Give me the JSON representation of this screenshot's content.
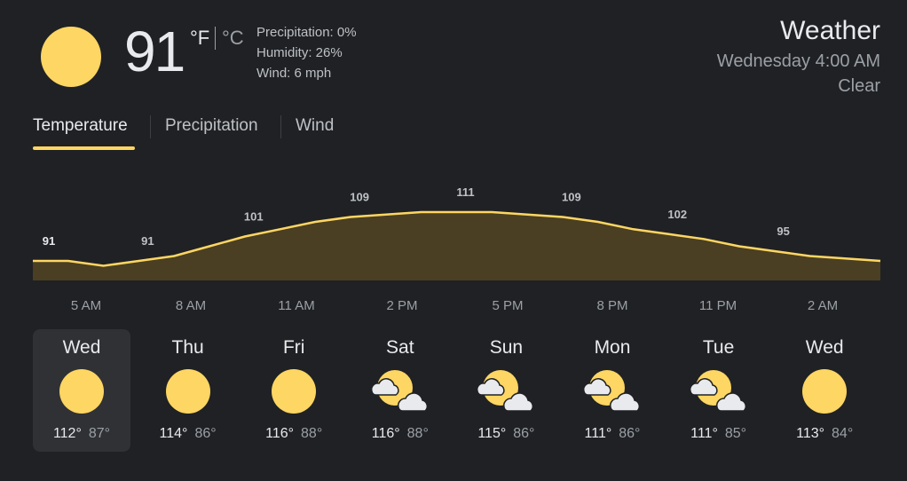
{
  "current": {
    "temperature": "91",
    "unit_f": "°F",
    "unit_c": "°C",
    "precipitation": "Precipitation: 0%",
    "humidity": "Humidity: 26%",
    "wind": "Wind: 6 mph",
    "icon": "sun-icon"
  },
  "header": {
    "title": "Weather",
    "datetime": "Wednesday 4:00 AM",
    "condition": "Clear"
  },
  "tabs": [
    {
      "label": "Temperature",
      "active": true
    },
    {
      "label": "Precipitation",
      "active": false
    },
    {
      "label": "Wind",
      "active": false
    }
  ],
  "colors": {
    "accent": "#fdd663",
    "background": "#202124",
    "chart_fill": "#4a3f22"
  },
  "chart_data": {
    "type": "area",
    "x": [
      "4AM",
      "5AM",
      "6AM",
      "7AM",
      "8AM",
      "9AM",
      "10AM",
      "11AM",
      "12PM",
      "1PM",
      "2PM",
      "3PM",
      "4PM",
      "5PM",
      "6PM",
      "7PM",
      "8PM",
      "9PM",
      "10PM",
      "11PM",
      "12AM",
      "1AM",
      "2AM",
      "3AM",
      "4AM"
    ],
    "y": [
      91,
      91,
      89,
      91,
      93,
      97,
      101,
      104,
      107,
      109,
      110,
      111,
      111,
      111,
      110,
      109,
      107,
      104,
      102,
      100,
      97,
      95,
      93,
      92,
      91
    ],
    "labels": [
      {
        "index": 0,
        "text": "91"
      },
      {
        "index": 3,
        "text": "91"
      },
      {
        "index": 6,
        "text": "101"
      },
      {
        "index": 9,
        "text": "109"
      },
      {
        "index": 12,
        "text": "111"
      },
      {
        "index": 15,
        "text": "109"
      },
      {
        "index": 18,
        "text": "102"
      },
      {
        "index": 21,
        "text": "95"
      }
    ],
    "tick_labels": [
      "5 AM",
      "8 AM",
      "11 AM",
      "2 PM",
      "5 PM",
      "8 PM",
      "11 PM",
      "2 AM"
    ],
    "ylim": [
      60,
      120
    ]
  },
  "days": [
    {
      "name": "Wed",
      "icon": "sun-icon",
      "hi": "112°",
      "lo": "87°",
      "selected": true
    },
    {
      "name": "Thu",
      "icon": "sun-icon",
      "hi": "114°",
      "lo": "86°",
      "selected": false
    },
    {
      "name": "Fri",
      "icon": "sun-icon",
      "hi": "116°",
      "lo": "88°",
      "selected": false
    },
    {
      "name": "Sat",
      "icon": "partly-cloudy-icon",
      "hi": "116°",
      "lo": "88°",
      "selected": false
    },
    {
      "name": "Sun",
      "icon": "partly-cloudy-icon",
      "hi": "115°",
      "lo": "86°",
      "selected": false
    },
    {
      "name": "Mon",
      "icon": "partly-cloudy-icon",
      "hi": "111°",
      "lo": "86°",
      "selected": false
    },
    {
      "name": "Tue",
      "icon": "partly-cloudy-icon",
      "hi": "111°",
      "lo": "85°",
      "selected": false
    },
    {
      "name": "Wed",
      "icon": "sun-icon",
      "hi": "113°",
      "lo": "84°",
      "selected": false
    }
  ]
}
